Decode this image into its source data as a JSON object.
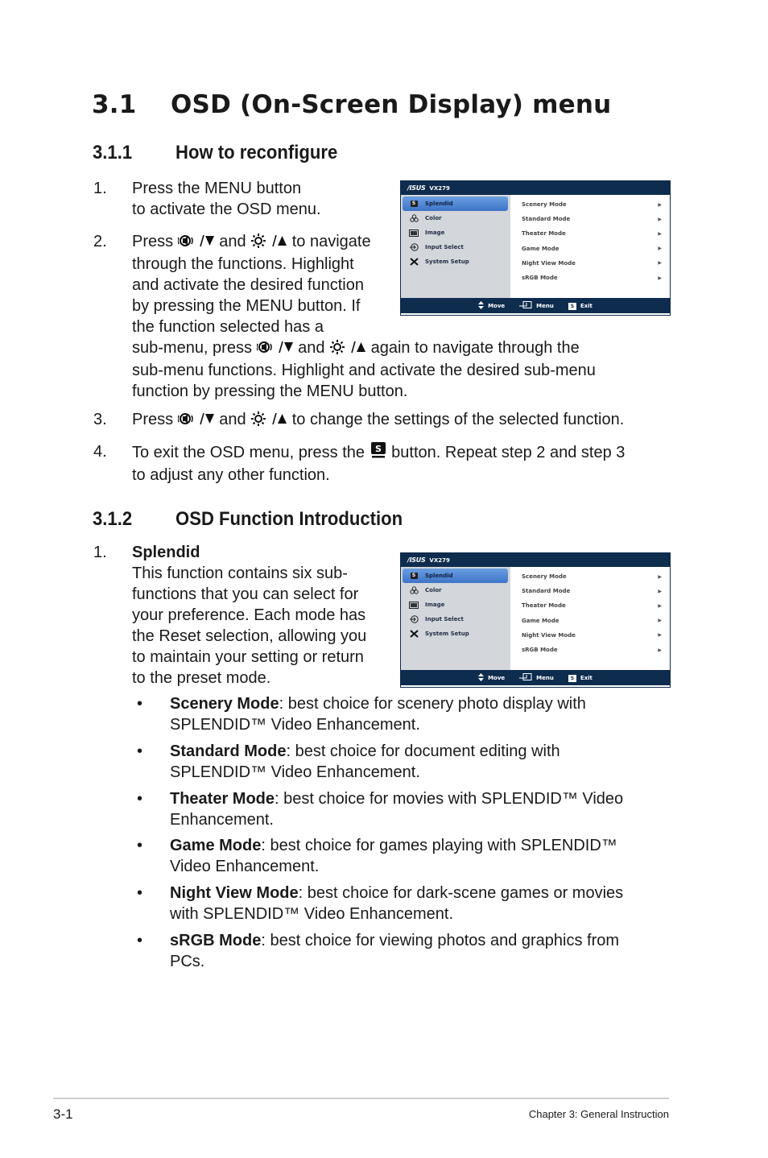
{
  "heading": {
    "number": "3.1",
    "title": "OSD (On-Screen Display) menu"
  },
  "section1": {
    "number": "3.1.1",
    "title": "How to reconfigure",
    "steps": [
      {
        "num": "1.",
        "lines": [
          "Press the MENU button",
          "to activate the OSD menu."
        ]
      },
      {
        "num": "2.",
        "press": "Press",
        "and": "and",
        "tail1": "to navigate",
        "lines": [
          "through the functions. Highlight",
          "and activate the desired function",
          "by pressing the MENU button. If",
          "the function selected has a"
        ],
        "sub_pre": "sub-menu, press",
        "sub_and": "and",
        "sub_tail": "again to navigate through the",
        "lines2": [
          "sub-menu functions. Highlight and activate the desired sub-menu",
          "function by pressing the MENU button."
        ]
      },
      {
        "num": "3.",
        "press": "Press",
        "and": "and",
        "tail": "to change the settings of the selected function."
      },
      {
        "num": "4.",
        "pre": "To exit the OSD menu, press the",
        "post": "button. Repeat step 2 and step 3",
        "line2": "to adjust any other function."
      }
    ]
  },
  "section2": {
    "number": "3.1.2",
    "title": "OSD Function Introduction",
    "item": {
      "num": "1.",
      "title": "Splendid",
      "lines": [
        "This function contains six sub-",
        "functions that you can select for",
        "your preference. Each mode has",
        "the Reset selection, allowing you",
        "to maintain your setting or return",
        "to the preset mode."
      ]
    },
    "bullets": [
      {
        "term": "Scenery Mode",
        "l1": ": best choice for scenery photo display with",
        "l2": "SPLENDID™ Video Enhancement."
      },
      {
        "term": "Standard Mode",
        "l1": ": best choice for document editing with",
        "l2": "SPLENDID™ Video Enhancement."
      },
      {
        "term": "Theater Mode",
        "l1": ": best choice for movies with SPLENDID™ Video",
        "l2": "Enhancement."
      },
      {
        "term": "Game Mode",
        "l1": ": best choice for games playing with SPLENDID™",
        "l2": "Video Enhancement."
      },
      {
        "term": "Night View Mode",
        "l1": ": best choice for dark-scene games or movies",
        "l2": "with SPLENDID™ Video Enhancement."
      },
      {
        "term": "sRGB Mode",
        "l1": ": best choice for viewing photos and graphics from",
        "l2": "PCs."
      }
    ]
  },
  "osd": {
    "brand": "/ISUS",
    "model": "VX279",
    "menu": [
      {
        "label": "Splendid",
        "icon": "splendid-s-icon",
        "selected": true
      },
      {
        "label": "Color",
        "icon": "color-icon"
      },
      {
        "label": "Image",
        "icon": "image-icon"
      },
      {
        "label": "Input Select",
        "icon": "input-select-icon"
      },
      {
        "label": "System Setup",
        "icon": "system-setup-icon"
      }
    ],
    "submenu": [
      "Scenery Mode",
      "Standard Mode",
      "Theater Mode",
      "Game Mode",
      "Night View Mode",
      "sRGB Mode"
    ],
    "footer": {
      "move": "Move",
      "menu": "Menu",
      "exit": "Exit",
      "s_key": "S"
    }
  },
  "footer": {
    "page": "3-1",
    "chapter": "Chapter 3: General Instruction"
  }
}
